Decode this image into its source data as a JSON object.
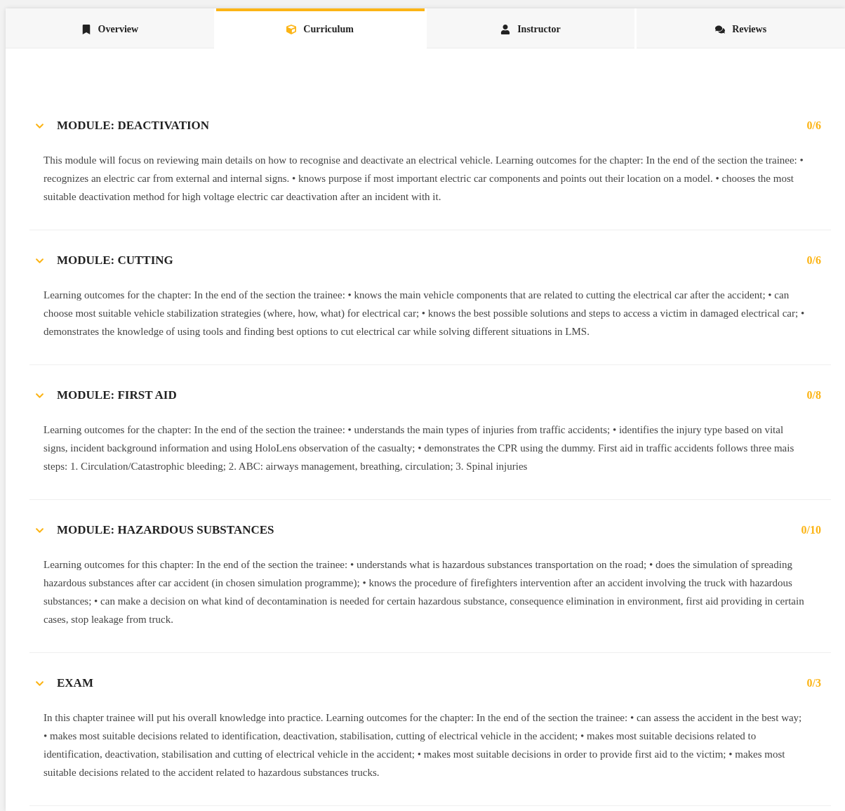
{
  "tabs": [
    {
      "label": "Overview",
      "selected": false
    },
    {
      "label": "Curriculum",
      "selected": true
    },
    {
      "label": "Instructor",
      "selected": false
    },
    {
      "label": "Reviews",
      "selected": false
    }
  ],
  "modules": [
    {
      "title": "MODULE: DEACTIVATION",
      "count": "0/6",
      "expanded": true,
      "description": "This module will focus on reviewing main details on how to recognise and deactivate an electrical vehicle. Learning outcomes for the chapter: In the end of the section the trainee: • recognizes an electric car from external and internal signs. • knows purpose if most important electric car components and points out their location on a model. • chooses the most suitable deactivation method for high voltage electric car deactivation after an incident with it."
    },
    {
      "title": "MODULE: CUTTING",
      "count": "0/6",
      "expanded": true,
      "description": "Learning outcomes for the chapter: In the end of the section the trainee: • knows the main vehicle components that are related to cutting the electrical car after the accident; • can choose most suitable vehicle stabilization strategies (where, how, what) for electrical car; • knows the best possible solutions and steps to access a victim in damaged electrical car; • demonstrates the knowledge of using tools and finding best options to cut electrical car while solving different situations in LMS."
    },
    {
      "title": "MODULE: FIRST AID",
      "count": "0/8",
      "expanded": true,
      "description": "Learning outcomes for the chapter: In the end of the section the trainee: • understands the main types of injuries from traffic accidents; • identifies the injury type based on vital signs, incident background information and using HoloLens observation of the casualty; • demonstrates the CPR using the dummy. First aid in traffic accidents follows three mais steps: 1. Circulation/Catastrophic bleeding; 2. ABC: airways management, breathing, circulation; 3. Spinal injuries"
    },
    {
      "title": "MODULE: HAZARDOUS SUBSTANCES",
      "count": "0/10",
      "expanded": true,
      "description": "Learning outcomes for this chapter: In the end of the section the trainee: • understands what is hazardous substances transportation on the road; • does the simulation of spreading hazardous substances after car accident (in chosen simulation programme); • knows the procedure of firefighters intervention after an accident involving the truck with hazardous substances; • can make a decision on what kind of decontamination is needed for certain hazardous substance, consequence elimination in environment, first aid providing in certain cases, stop leakage from truck."
    },
    {
      "title": "EXAM",
      "count": "0/3",
      "expanded": true,
      "description": "In this chapter trainee will put his overall knowledge into practice. Learning outcomes for the chapter: In the end of the section the trainee: • can assess the accident in the best way; • makes most suitable decisions related to identification, deactivation, stabilisation, cutting of electrical vehicle in the accident; • makes most suitable decisions related to identification, deactivation, stabilisation and cutting of electrical vehicle in the accident; • makes most suitable decisions in order to provide first aid to the victim; • makes most suitable decisions related to the accident related to hazardous substances trucks."
    }
  ]
}
